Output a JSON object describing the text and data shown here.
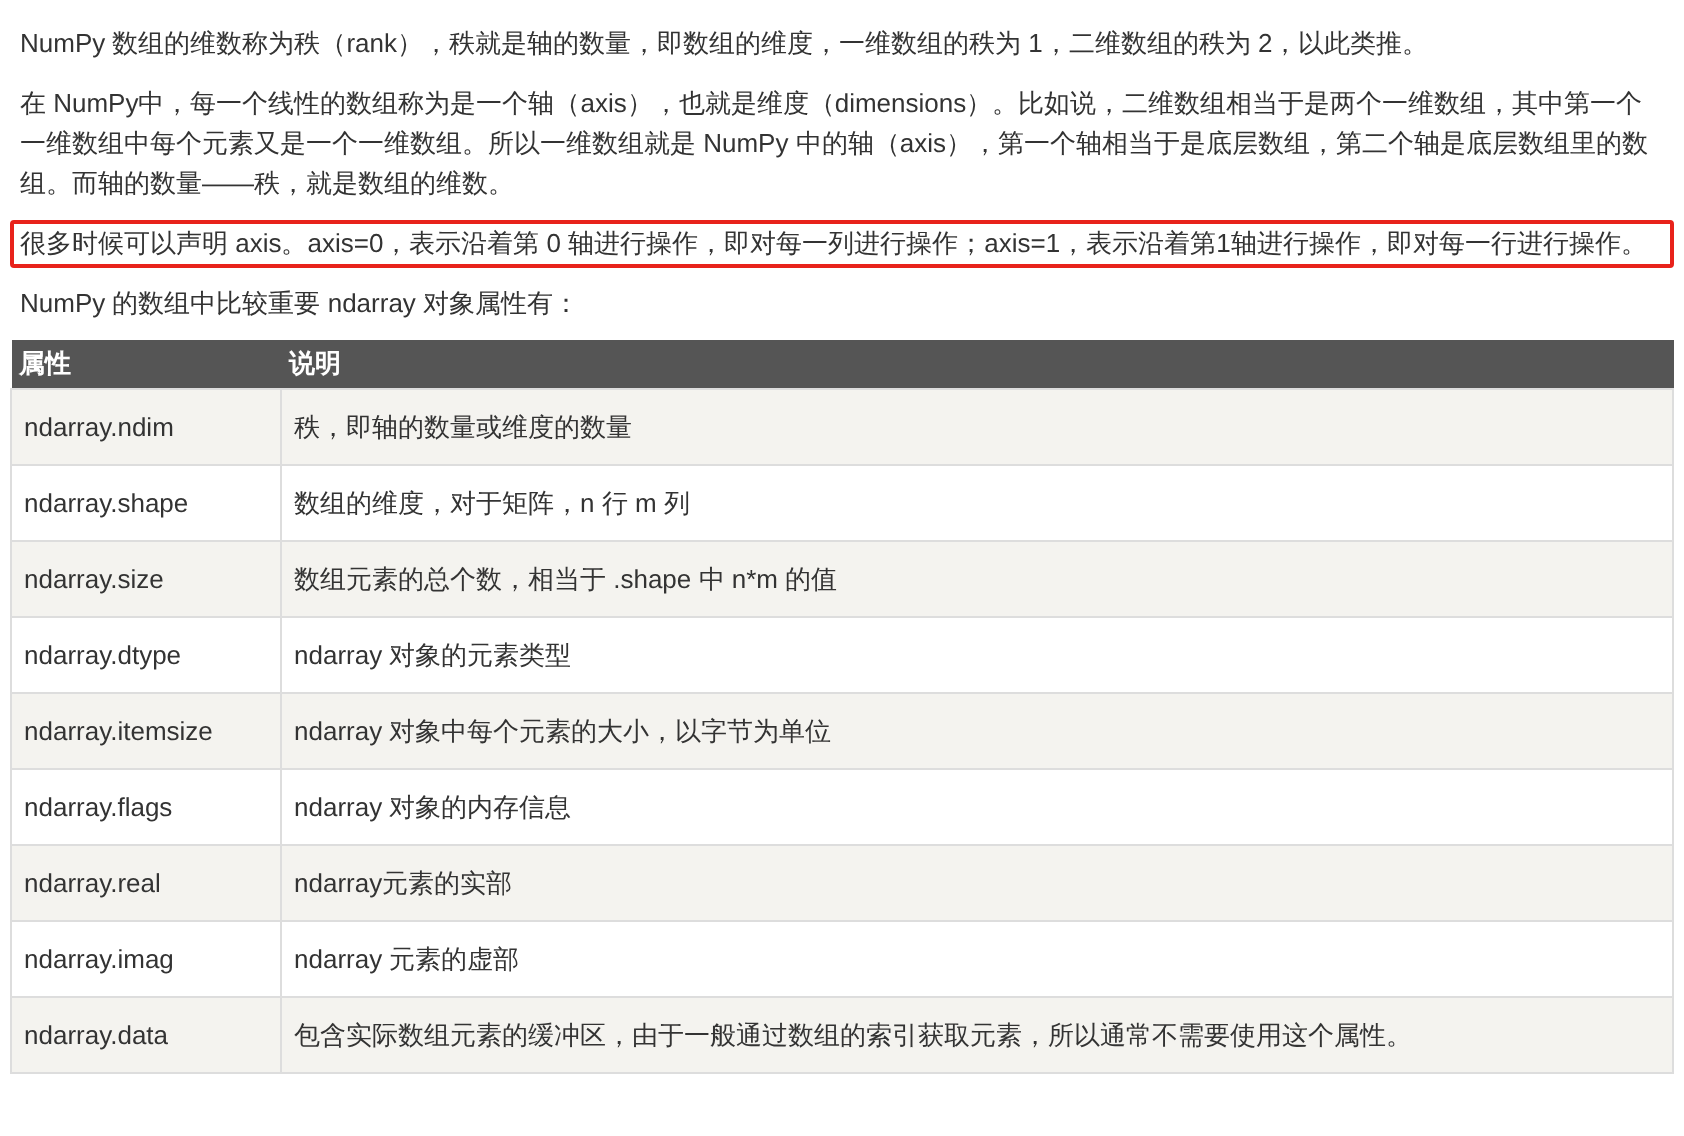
{
  "paragraphs": [
    {
      "text": "NumPy 数组的维数称为秩（rank），秩就是轴的数量，即数组的维度，一维数组的秩为 1，二维数组的秩为 2，以此类推。",
      "highlighted": false
    },
    {
      "text": "在 NumPy中，每一个线性的数组称为是一个轴（axis），也就是维度（dimensions）。比如说，二维数组相当于是两个一维数组，其中第一个一维数组中每个元素又是一个一维数组。所以一维数组就是 NumPy 中的轴（axis），第一个轴相当于是底层数组，第二个轴是底层数组里的数组。而轴的数量——秩，就是数组的维数。",
      "highlighted": false
    },
    {
      "text": "很多时候可以声明 axis。axis=0，表示沿着第 0 轴进行操作，即对每一列进行操作；axis=1，表示沿着第1轴进行操作，即对每一行进行操作。",
      "highlighted": true
    },
    {
      "text": "NumPy 的数组中比较重要 ndarray 对象属性有：",
      "highlighted": false
    }
  ],
  "table": {
    "columns": [
      "属性",
      "说明"
    ],
    "rows": [
      [
        "ndarray.ndim",
        "秩，即轴的数量或维度的数量"
      ],
      [
        "ndarray.shape",
        "数组的维度，对于矩阵，n 行 m 列"
      ],
      [
        "ndarray.size",
        "数组元素的总个数，相当于 .shape 中 n*m 的值"
      ],
      [
        "ndarray.dtype",
        "ndarray 对象的元素类型"
      ],
      [
        "ndarray.itemsize",
        "ndarray 对象中每个元素的大小，以字节为单位"
      ],
      [
        "ndarray.flags",
        "ndarray 对象的内存信息"
      ],
      [
        "ndarray.real",
        "ndarray元素的实部"
      ],
      [
        "ndarray.imag",
        "ndarray 元素的虚部"
      ],
      [
        "ndarray.data",
        "包含实际数组元素的缓冲区，由于一般通过数组的索引获取元素，所以通常不需要使用这个属性。"
      ]
    ]
  }
}
